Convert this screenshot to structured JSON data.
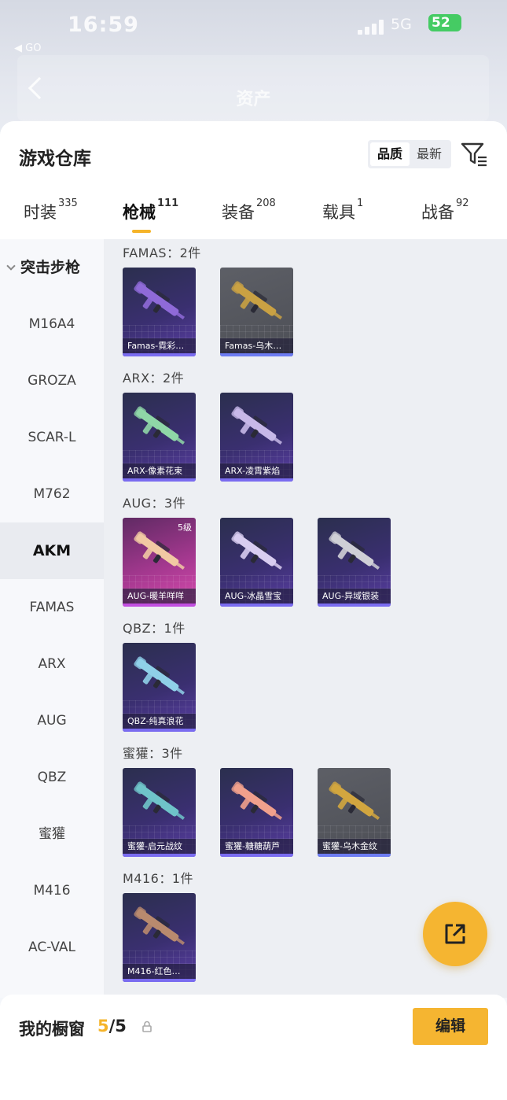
{
  "status_bar": {
    "time": "16:59",
    "back_app": "◀ GO",
    "network": "5G",
    "battery": "52"
  },
  "app_header": {
    "title": "资产"
  },
  "sheet": {
    "title": "游戏仓库",
    "sort": {
      "options": [
        "品质",
        "最新"
      ],
      "selected": "品质"
    },
    "tabs": [
      {
        "label": "时装",
        "count": "335"
      },
      {
        "label": "枪械",
        "count": "111",
        "active": true
      },
      {
        "label": "装备",
        "count": "208"
      },
      {
        "label": "载具",
        "count": "1"
      },
      {
        "label": "战备",
        "count": "92"
      }
    ]
  },
  "sidebar": {
    "header": "突击步枪",
    "items": [
      "M16A4",
      "GROZA",
      "SCAR-L",
      "M762",
      "AKM",
      "FAMAS",
      "ARX",
      "AUG",
      "QBZ",
      "蜜獾",
      "M416",
      "AC-VAL"
    ],
    "active": "AKM"
  },
  "groups": [
    {
      "title": "FAMAS：2件",
      "items": [
        {
          "name": "Famas-霓彩…",
          "style": "purple",
          "gun_color": "#8f6ad8"
        },
        {
          "name": "Famas-乌木…",
          "style": "gray",
          "gun_color": "#c9a143"
        }
      ]
    },
    {
      "title": "ARX：2件",
      "items": [
        {
          "name": "ARX-像素花束",
          "style": "purple",
          "gun_color": "#8fd7a7"
        },
        {
          "name": "ARX-凌霄紫焰",
          "style": "purple",
          "gun_color": "#c7b8e8"
        }
      ]
    },
    {
      "title": "AUG：3件",
      "items": [
        {
          "name": "AUG-暖羊咩咩",
          "style": "pink",
          "gun_color": "#f1c9a3",
          "level": "5级"
        },
        {
          "name": "AUG-冰晶雪宝",
          "style": "purple",
          "gun_color": "#d8cdf0"
        },
        {
          "name": "AUG-异域银装",
          "style": "purple",
          "gun_color": "#cfcfd6"
        }
      ]
    },
    {
      "title": "QBZ：1件",
      "items": [
        {
          "name": "QBZ-纯真浪花",
          "style": "purple",
          "gun_color": "#8fd0e8"
        }
      ]
    },
    {
      "title": "蜜獾：3件",
      "items": [
        {
          "name": "蜜獾-启元战纹",
          "style": "purple",
          "gun_color": "#6fc4c9"
        },
        {
          "name": "蜜獾-糖糖葫芦",
          "style": "purple",
          "gun_color": "#f0a08c"
        },
        {
          "name": "蜜獾-乌木金纹",
          "style": "gray",
          "gun_color": "#d2a63f"
        }
      ]
    },
    {
      "title": "M416：1件",
      "items": [
        {
          "name": "M416-红色…",
          "style": "purple",
          "gun_color": "#b98a6e"
        }
      ]
    }
  ],
  "showcase": {
    "title": "我的橱窗",
    "current": "5",
    "total": "/5",
    "edit_label": "编辑"
  },
  "colors": {
    "accent": "#f5b42a",
    "card_purple": "#3a2f70",
    "card_gray": "#55575e",
    "card_pink": "#a4388f"
  }
}
